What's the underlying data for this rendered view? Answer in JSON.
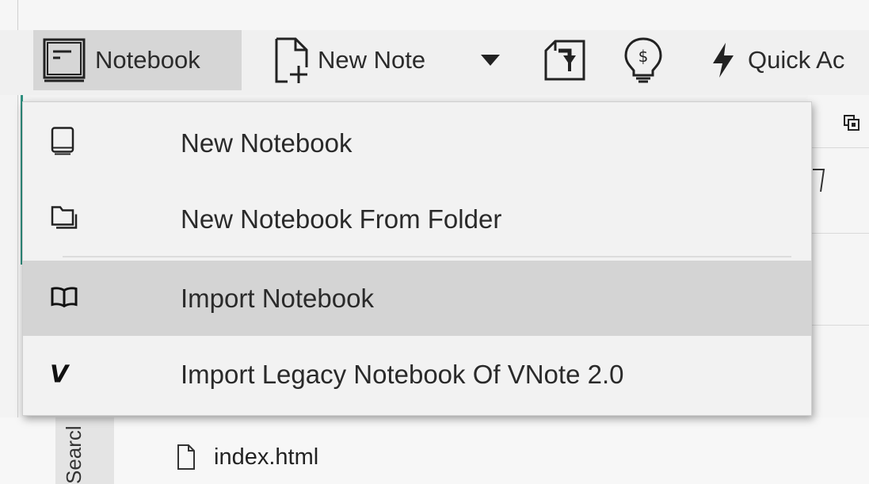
{
  "toolbar": {
    "notebook_label": "Notebook",
    "new_note_label": "New Note",
    "quick_access_label": "Quick Ac"
  },
  "menu": {
    "items": [
      {
        "label": "New Notebook",
        "icon": "notebook-icon"
      },
      {
        "label": "New Notebook From Folder",
        "icon": "folder-icon"
      },
      {
        "label": "Import Notebook",
        "icon": "open-book-icon"
      },
      {
        "label": "Import Legacy Notebook Of VNote 2.0",
        "icon": "vnote-logo-icon"
      }
    ],
    "highlighted_index": 2
  },
  "side_tab": {
    "label": "Searcl"
  },
  "file_list": [
    {
      "name": "index.html",
      "icon": "file-icon"
    }
  ],
  "colors": {
    "accent": "#2f8f7f",
    "menu_bg": "#f2f2f2",
    "highlight": "#d4d4d4"
  }
}
